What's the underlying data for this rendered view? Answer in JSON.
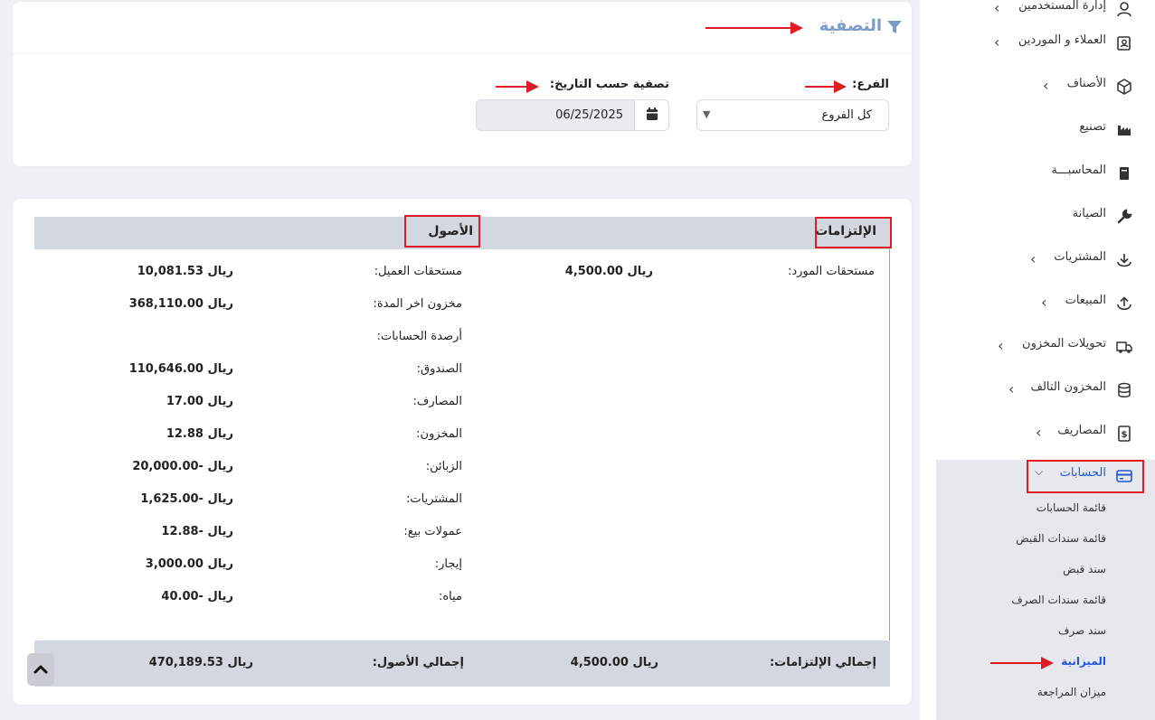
{
  "filter": {
    "title": "التصفية",
    "branch_label": "الفرع:",
    "branch_value": "كل الفروع",
    "date_label": "تصفية حسب التاريخ:",
    "date_value": "06/25/2025"
  },
  "balance_sheet": {
    "liabilities_header": "الإلتزامات",
    "assets_header": "الأصول",
    "liabilities_rows": [
      {
        "label": "مستحقات المورد:",
        "value": "ريال 4,500.00"
      }
    ],
    "asset_rows": [
      {
        "label": "مستحقات العميل:",
        "value": "ريال 10,081.53"
      },
      {
        "label": "مخزون اخر المدة:",
        "value": "ريال 368,110.00"
      },
      {
        "label": "أرصدة الحسابات:",
        "value": ""
      },
      {
        "label": "الصندوق:",
        "value": "ريال 110,646.00"
      },
      {
        "label": "المصارف:",
        "value": "ريال 17.00"
      },
      {
        "label": "المخزون:",
        "value": "ريال 12.88"
      },
      {
        "label": "الزبائن:",
        "value": "ريال -20,000.00"
      },
      {
        "label": "المشتريات:",
        "value": "ريال -1,625.00"
      },
      {
        "label": "عمولات بيع:",
        "value": "ريال -12.88"
      },
      {
        "label": "إيجار:",
        "value": "ريال 3,000.00"
      },
      {
        "label": "مياه:",
        "value": "ريال -40.00"
      }
    ],
    "total_liabilities_label": "إجمالي الإلتزامات:",
    "total_liabilities_value": "ريال 4,500.00",
    "total_assets_label": "إجمالي الأصول:",
    "total_assets_value": "ريال 470,189.53"
  },
  "sidebar": {
    "items": [
      {
        "label": "إدارة المستخدمين",
        "icon": "user-icon",
        "has_chevron": true
      },
      {
        "label": "العملاء و الموردين",
        "icon": "contacts-icon",
        "has_chevron": true
      },
      {
        "label": "الأصناف",
        "icon": "box-icon",
        "has_chevron": true
      },
      {
        "label": "تصنيع",
        "icon": "factory-icon",
        "has_chevron": false
      },
      {
        "label": "المحاسبـــة",
        "icon": "book-icon",
        "has_chevron": false
      },
      {
        "label": "الصيانة",
        "icon": "wrench-icon",
        "has_chevron": false
      },
      {
        "label": "المشتريات",
        "icon": "download-icon",
        "has_chevron": true
      },
      {
        "label": "المبيعات",
        "icon": "upload-icon",
        "has_chevron": true
      },
      {
        "label": "تحويلات المخزون",
        "icon": "truck-icon",
        "has_chevron": true
      },
      {
        "label": "المخزون التالف",
        "icon": "database-icon",
        "has_chevron": true
      },
      {
        "label": "المصاريف",
        "icon": "receipt-icon",
        "has_chevron": true
      }
    ],
    "active_group": {
      "label": "الحسابات",
      "icon": "credit-card-icon"
    },
    "sub_items": [
      {
        "label": "قائمة الحسابات"
      },
      {
        "label": "قائمة سندات القبض"
      },
      {
        "label": "سند قبض"
      },
      {
        "label": "قائمة سندات الصرف"
      },
      {
        "label": "سند صرف"
      },
      {
        "label": "الميزانية"
      },
      {
        "label": "ميزان المراجعة"
      }
    ]
  },
  "colors": {
    "accent": "#1f57d6",
    "filter_title": "#7a9cc7",
    "annotation_red": "#e01b24",
    "table_header_bg": "#d3d7df"
  }
}
